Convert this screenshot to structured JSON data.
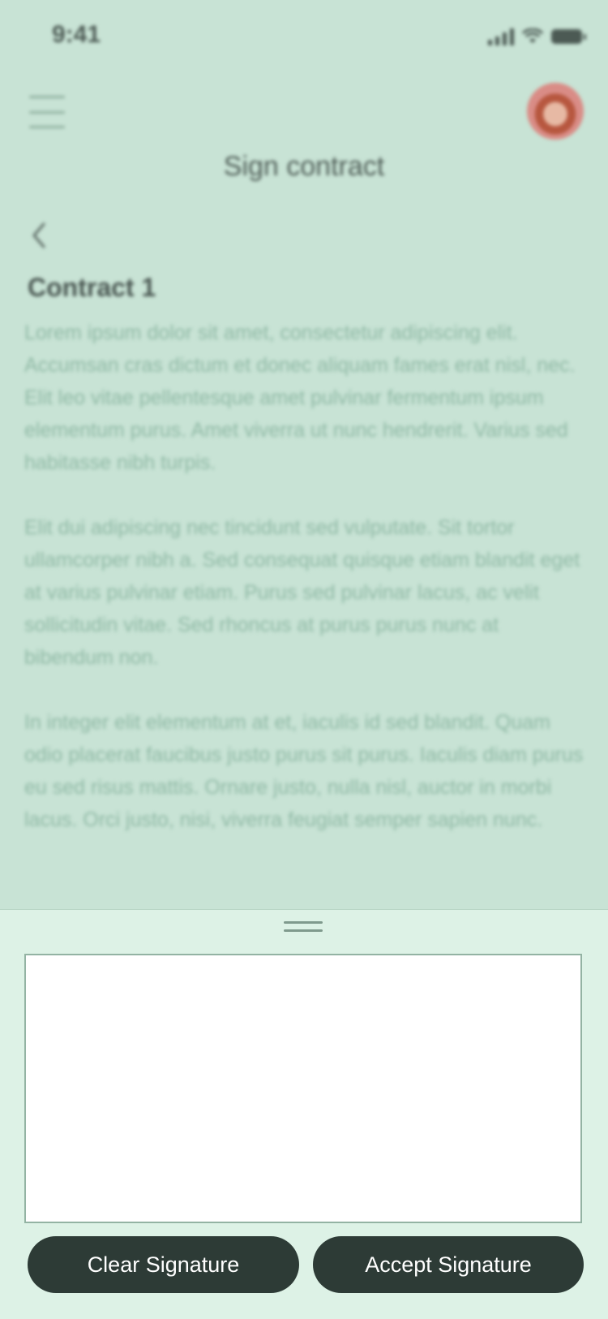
{
  "status_bar": {
    "time": "9:41"
  },
  "header": {
    "title": "Sign contract"
  },
  "contract": {
    "title": "Contract 1",
    "paragraphs": [
      "Lorem ipsum dolor sit amet, consectetur adipiscing elit. Accumsan cras dictum et donec aliquam fames erat nisl, nec. Elit leo vitae pellentesque amet pulvinar fermentum ipsum elementum purus. Amet viverra ut nunc hendrerit. Varius sed habitasse nibh turpis.",
      "Elit dui adipiscing nec tincidunt sed vulputate. Sit tortor ullamcorper nibh a. Sed consequat quisque etiam blandit eget at varius pulvinar etiam. Purus sed pulvinar lacus, ac velit sollicitudin vitae. Sed rhoncus at purus purus nunc at bibendum non.",
      "In integer elit elementum at et, iaculis id sed blandit. Quam odio placerat faucibus justo purus sit purus. Iaculis diam purus eu sed risus mattis. Ornare justo, nulla nisl, auctor in morbi lacus. Orci justo, nisi, viverra feugiat semper sapien nunc."
    ]
  },
  "signature_sheet": {
    "clear_label": "Clear Signature",
    "accept_label": "Accept Signature"
  },
  "icons": {
    "menu": "hamburger-icon",
    "back": "chevron-left-icon",
    "avatar": "user-avatar",
    "signal": "cellular-signal-icon",
    "wifi": "wifi-icon",
    "battery": "battery-icon"
  },
  "colors": {
    "background": "#c8e3d5",
    "sheet": "#ddf2e6",
    "button": "#2d3b36"
  }
}
